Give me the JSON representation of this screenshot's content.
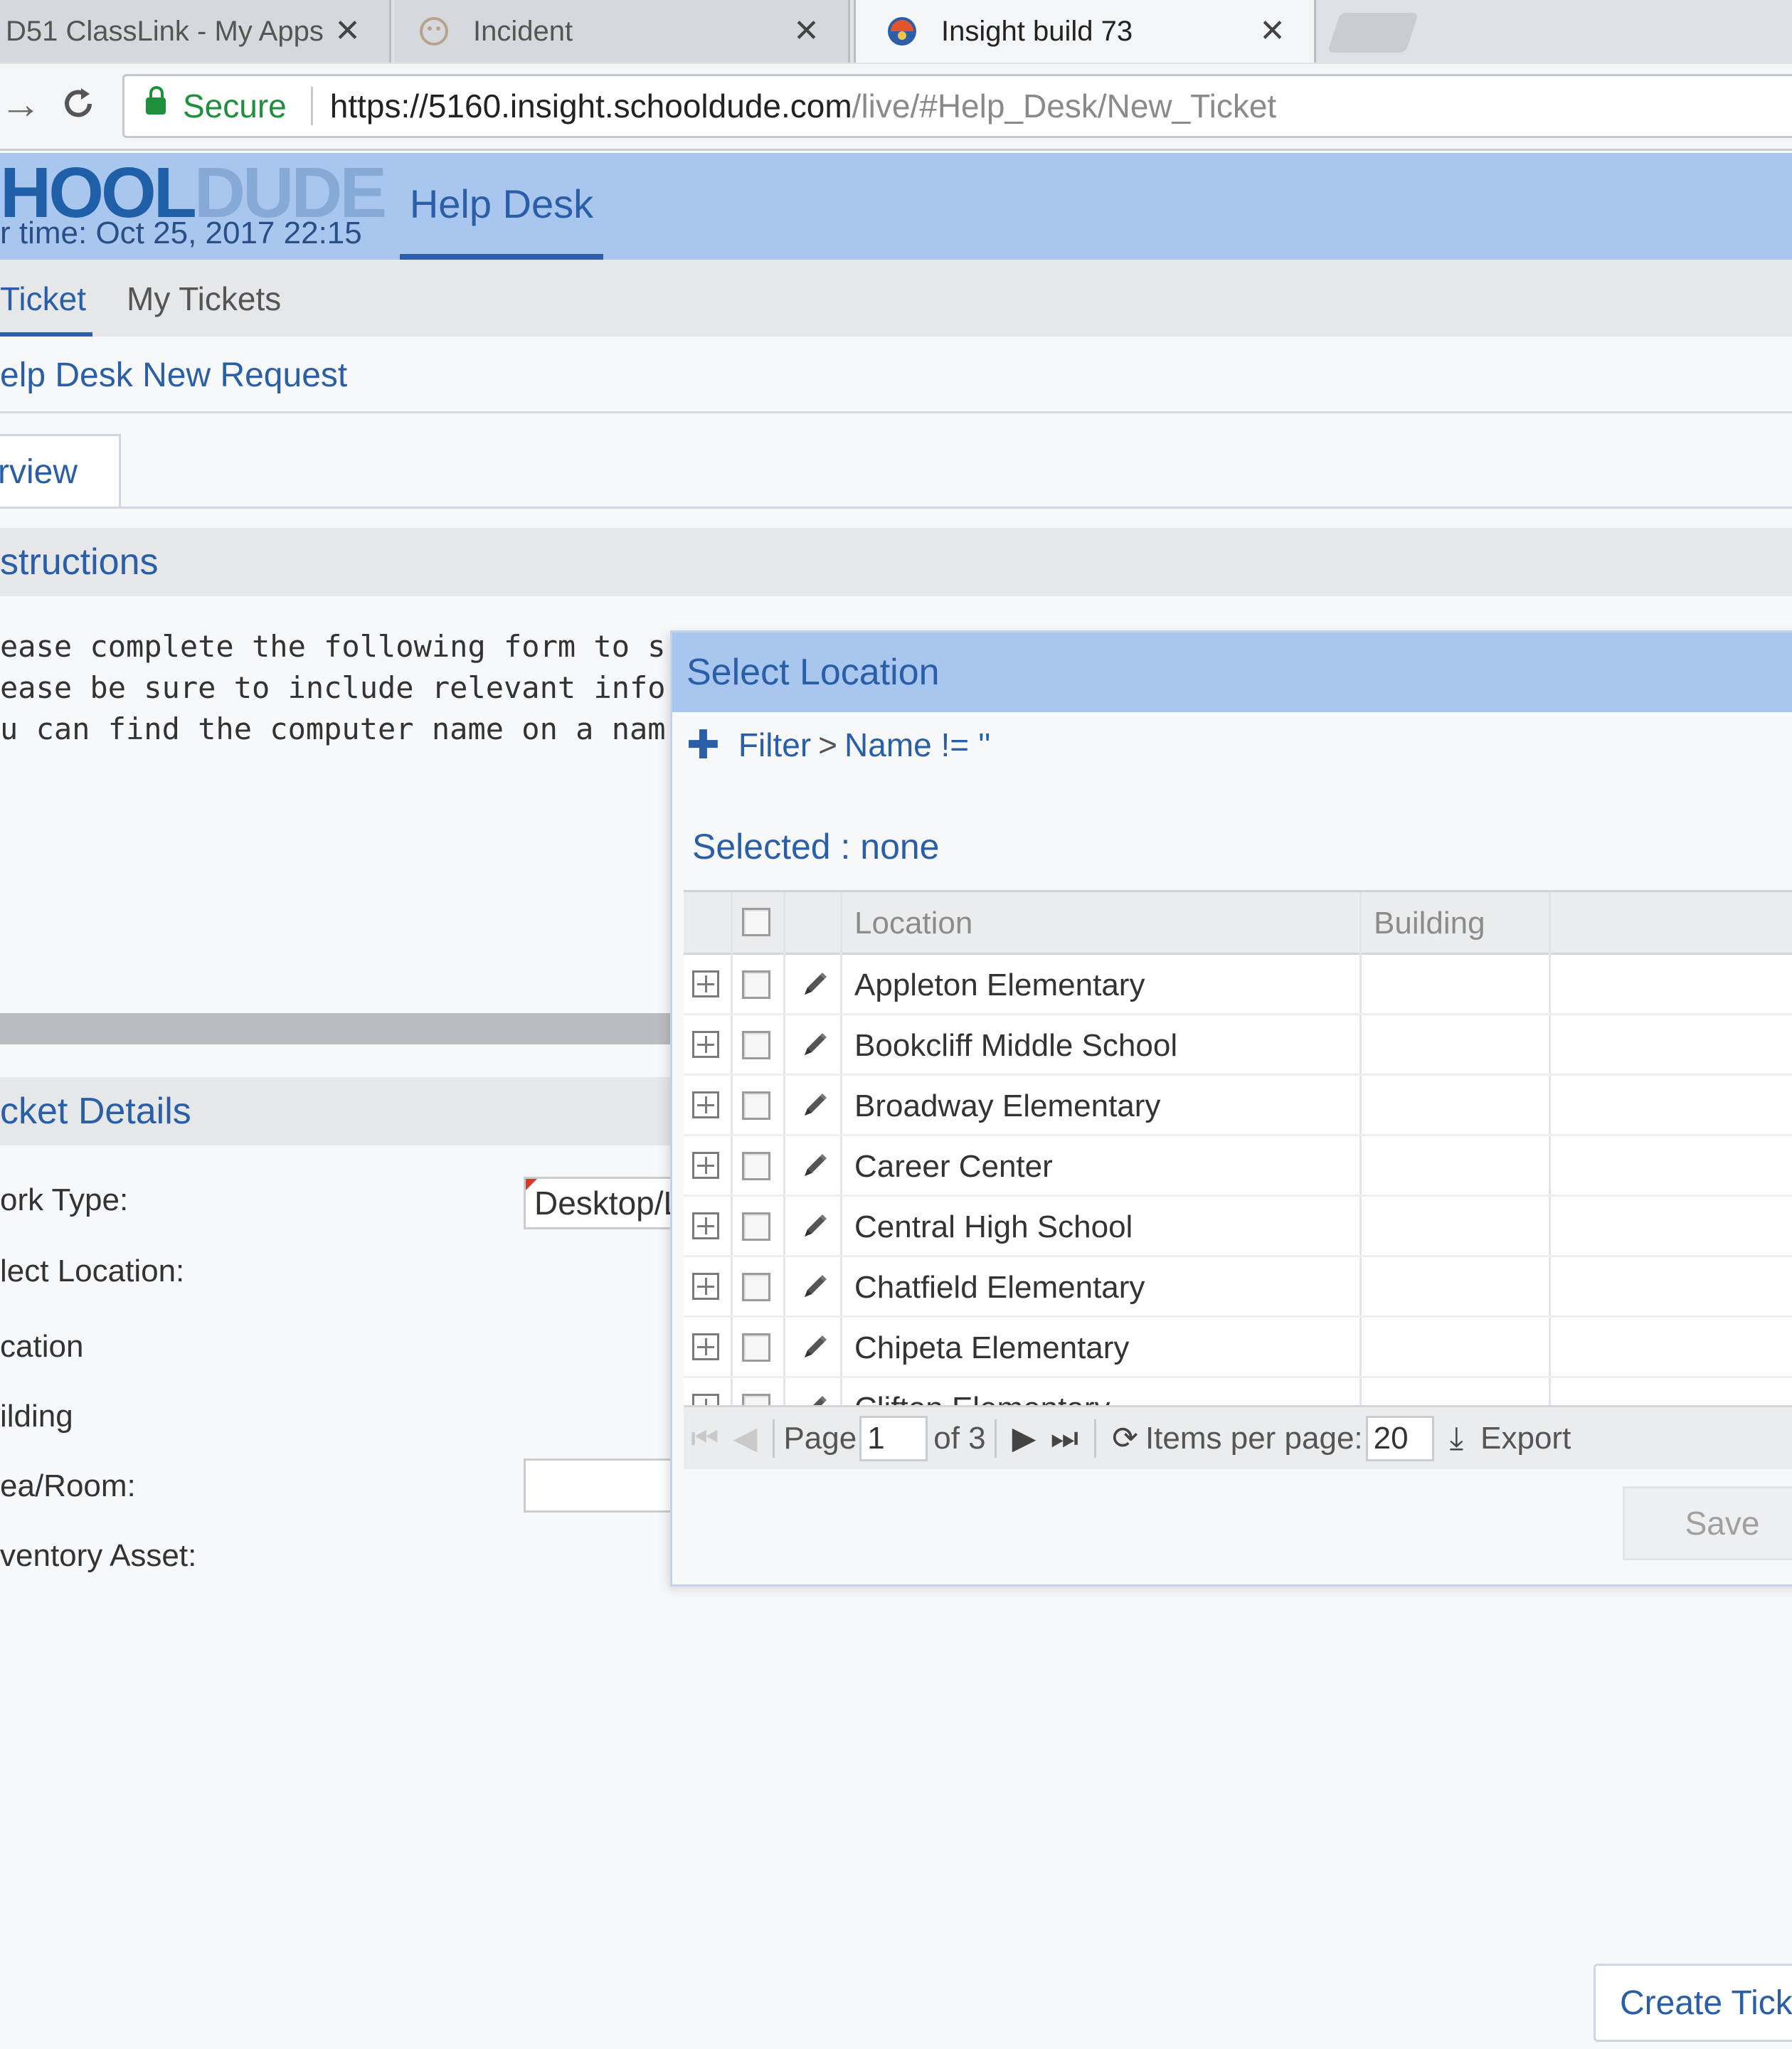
{
  "browser": {
    "tabs": [
      {
        "title": "D51 ClassLink - My Apps",
        "close": "✕"
      },
      {
        "title": "Incident",
        "close": "✕"
      },
      {
        "title": "Insight build 73",
        "close": "✕"
      }
    ],
    "secure_label": "Secure",
    "url_host": "https://5160.insight.schooldude.com",
    "url_path": "/live/#Help_Desk/New_Ticket"
  },
  "header": {
    "logo_dark": "HOOL",
    "logo_light": "DUDE",
    "server_time": "r time: Oct 25, 2017 22:15",
    "module_tab": "Help Desk"
  },
  "subnav": {
    "items": [
      "Ticket",
      "My Tickets"
    ]
  },
  "page_title": "elp Desk New Request",
  "overview_tab": "rview",
  "instructions": {
    "heading": "structions",
    "lines": [
      "ease complete the following form to s",
      "ease be sure to include relevant info",
      "u can find the computer name on a nam"
    ]
  },
  "ticket_details": {
    "heading": "cket Details",
    "labels": [
      "ork Type:",
      "lect Location:",
      "cation",
      "ilding",
      "ea/Room:",
      "ventory Asset:"
    ],
    "work_type_value": "Desktop/Laptop"
  },
  "create_button": "Create Ticket",
  "modal": {
    "title": "Select Location",
    "filter_prefix": "Filter",
    "filter_sep": ">",
    "filter_expr": "Name != ''",
    "selected": "Selected : none",
    "columns": [
      "Location",
      "Building"
    ],
    "rows": [
      "Appleton Elementary",
      "Bookcliff Middle School",
      "Broadway Elementary",
      "Career Center",
      "Central High School",
      "Chatfield Elementary",
      "Chipeta Elementary",
      "Clifton Elementary"
    ],
    "pager": {
      "page_label": "Page",
      "page_value": "1",
      "of_label": "of 3",
      "items_per_page_label": "Items per page:",
      "items_per_page_value": "20",
      "export_label": "Export"
    },
    "save_label": "Save"
  }
}
